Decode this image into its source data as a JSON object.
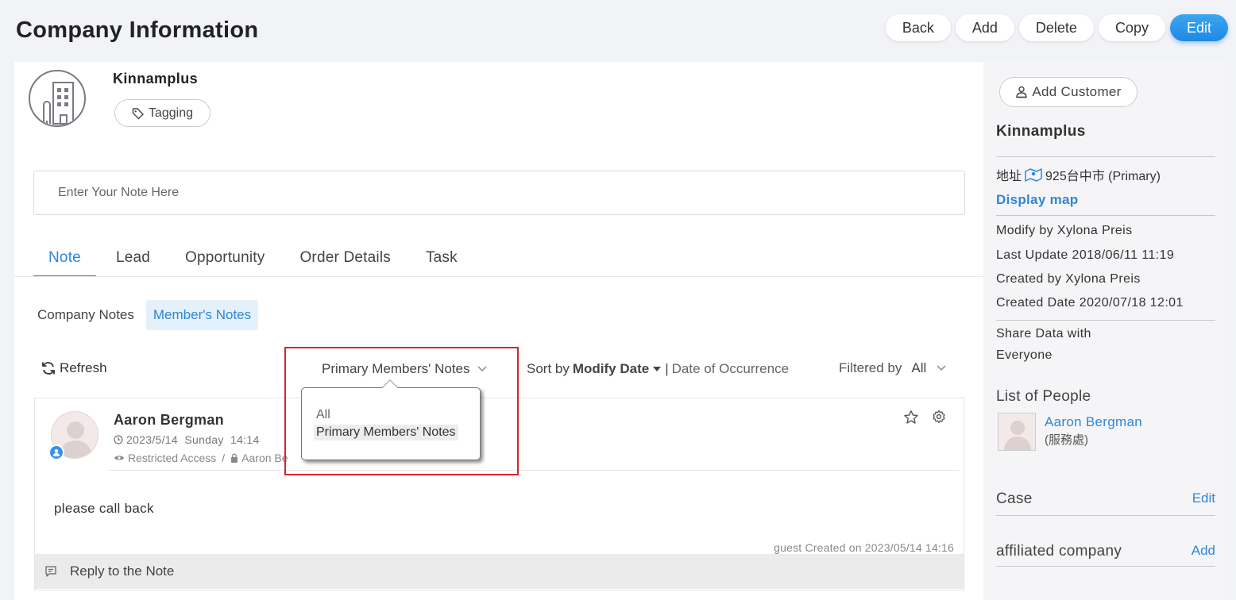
{
  "page": {
    "title": "Company Information"
  },
  "actions": {
    "back": "Back",
    "add": "Add",
    "delete": "Delete",
    "copy": "Copy",
    "edit": "Edit"
  },
  "company": {
    "name": "Kinnamplus",
    "tagging_label": "Tagging"
  },
  "note_input": {
    "placeholder": "Enter Your Note Here"
  },
  "tabs": [
    {
      "label": "Note",
      "active": true
    },
    {
      "label": "Lead"
    },
    {
      "label": "Opportunity"
    },
    {
      "label": "Order Details"
    },
    {
      "label": "Task"
    }
  ],
  "subtabs": [
    {
      "label": "Company Notes"
    },
    {
      "label": "Member's Notes",
      "active": true
    }
  ],
  "toolbar": {
    "refresh_label": "Refresh",
    "notes_filter_value": "Primary Members' Notes",
    "sort_prefix": "Sort by",
    "sort_key": "Modify Date",
    "sort_separator": "|",
    "sort_alt": "Date of Occurrence",
    "filtered_label": "Filtered by",
    "filtered_value": "All"
  },
  "dropdown": {
    "options": [
      "All",
      "Primary Members' Notes"
    ],
    "selected": "Primary Members' Notes"
  },
  "note": {
    "author": "Aaron Bergman",
    "date": "2023/5/14  Sunday  14:14",
    "access": "Restricted Access",
    "access_sep": "/",
    "access_member": "Aaron Be",
    "body": "please call back",
    "meta": "guest Created on 2023/05/14 14:16",
    "reply_label": "Reply to the Note"
  },
  "sidebar": {
    "add_customer_label": "Add Customer",
    "company_name": "Kinnamplus",
    "address_label": "地址",
    "address_value": "925台中市 (Primary)",
    "display_map": "Display map",
    "modify_by": "Modify by Xylona Preis",
    "last_update": "Last Update 2018/06/11 11:19",
    "created_by": "Created by Xylona Preis",
    "created_date": "Created Date 2020/07/18 12:01",
    "share_label": "Share Data with",
    "share_value": "Everyone",
    "people_title": "List of People",
    "person_name": "Aaron Bergman",
    "person_role": "(服務處)",
    "case_label": "Case",
    "case_action": "Edit",
    "affiliated_label": "affiliated company",
    "affiliated_action": "Add"
  },
  "colors": {
    "accent": "#2f86d6",
    "edit_button": "#1e88e5",
    "highlight": "#d9232a"
  }
}
